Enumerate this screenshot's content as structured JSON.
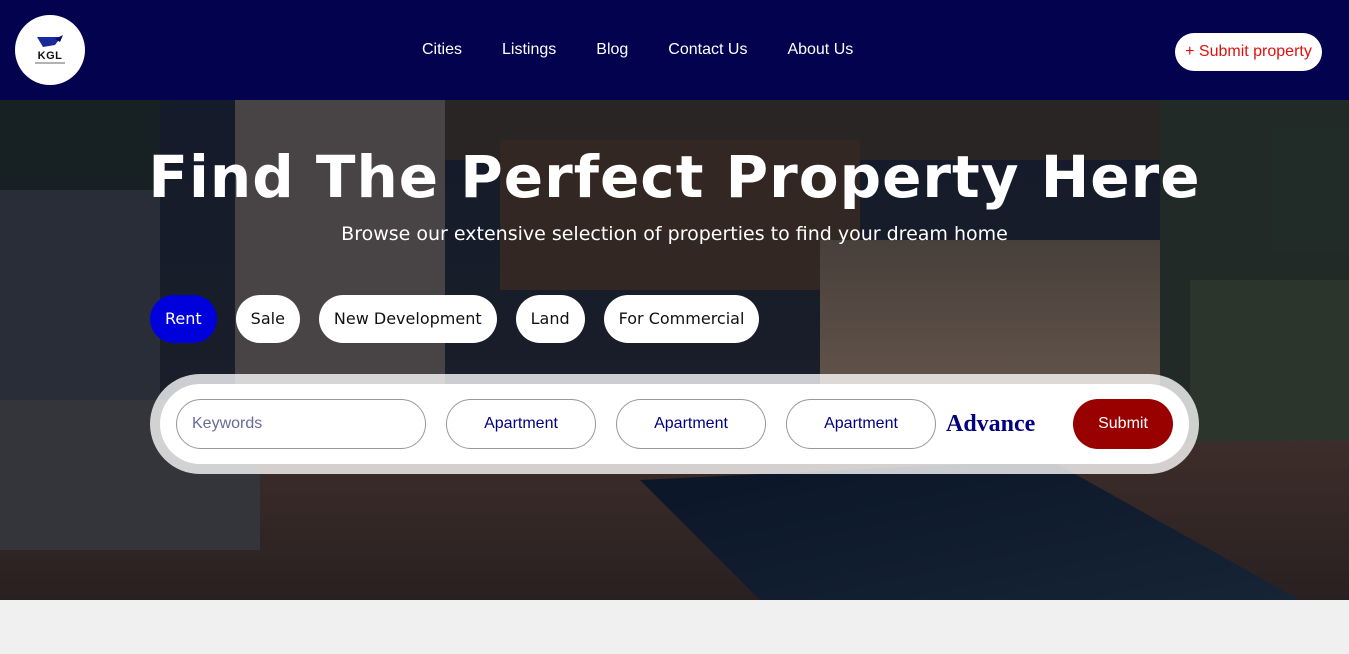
{
  "brand": {
    "logo_text": "KGL"
  },
  "nav": {
    "links": [
      "Cities",
      "Listings",
      "Blog",
      "Contact Us",
      "About Us"
    ],
    "submit_property": "+ Submit property"
  },
  "hero": {
    "title": "Find The Perfect Property Here",
    "subtitle": "Browse our extensive selection of properties to find your dream home"
  },
  "tabs": [
    {
      "label": "Rent",
      "active": true
    },
    {
      "label": "Sale",
      "active": false
    },
    {
      "label": "New Development",
      "active": false
    },
    {
      "label": "Land",
      "active": false
    },
    {
      "label": "For Commercial",
      "active": false
    }
  ],
  "search": {
    "keywords_placeholder": "Keywords",
    "select_1": "Apartment",
    "select_2": "Apartment",
    "select_3": "Apartment",
    "advance_label": "Advance",
    "submit_label": "Submit"
  },
  "colors": {
    "navbar": "#02024f",
    "submit_property_text": "#e01010",
    "active_tab": "#0000dd",
    "select_text": "#000080",
    "submit_button": "#990000",
    "page_background": "#f0f0f0"
  }
}
